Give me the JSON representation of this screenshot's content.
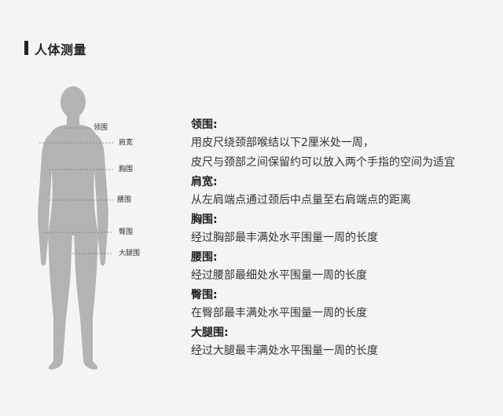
{
  "header": {
    "title": "人体测量"
  },
  "figure": {
    "labels": [
      {
        "key": "neck",
        "text": "领围"
      },
      {
        "key": "shoulder",
        "text": "肩宽"
      },
      {
        "key": "chest",
        "text": "胸围"
      },
      {
        "key": "waist",
        "text": "腰围"
      },
      {
        "key": "hip",
        "text": "臀围"
      },
      {
        "key": "thigh",
        "text": "大腿围"
      }
    ]
  },
  "descriptions": [
    {
      "title": "领围:",
      "lines": [
        "用皮尺绕颈部喉结以下2厘米处一周，",
        "皮尺与颈部之间保留约可以放入两个手指的空间为适宜"
      ]
    },
    {
      "title": "肩宽:",
      "lines": [
        "从左肩端点通过颈后中点量至右肩端点的距离"
      ]
    },
    {
      "title": "胸围:",
      "lines": [
        "经过胸部最丰满处水平围量一周的长度"
      ]
    },
    {
      "title": "腰围:",
      "lines": [
        "经过腰部最细处水平围量一周的长度"
      ]
    },
    {
      "title": "臀围:",
      "lines": [
        "在臀部最丰满处水平围量一周的长度"
      ]
    },
    {
      "title": "大腿围:",
      "lines": [
        "经过大腿最丰满处水平围量一周的长度"
      ]
    }
  ],
  "colors": {
    "figure": "#b3b3b3",
    "background": "#f4f4f4",
    "text": "#222222"
  }
}
